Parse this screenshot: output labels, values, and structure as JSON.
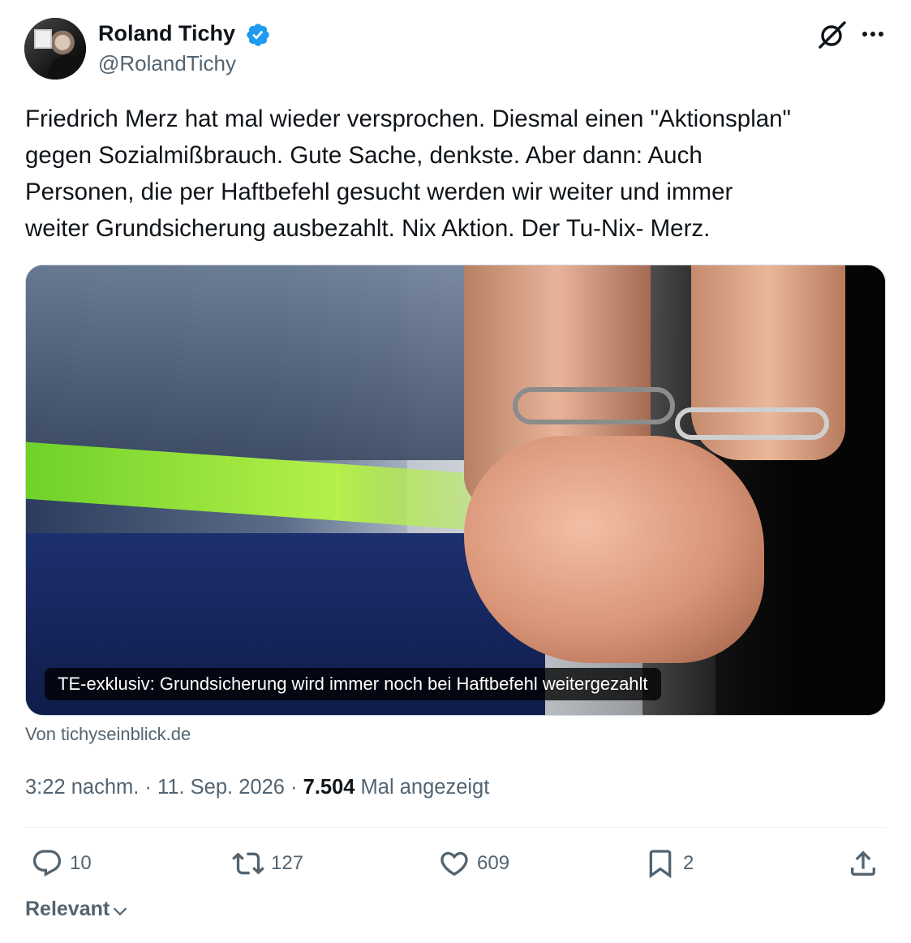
{
  "author": {
    "display_name": "Roland Tichy",
    "handle": "@RolandTichy",
    "verified": true,
    "verified_color": "#1d9bf0"
  },
  "tweet": {
    "text": "Friedrich Merz hat mal wieder versprochen. Diesmal einen \"Aktionsplan\"\ngegen Sozialmißbrauch. Gute Sache, denkste. Aber dann: Auch\nPersonen, die per Haftbefehl gesucht werden wir weiter und immer\nweiter Grundsicherung ausbezahlt. Nix Aktion. Der Tu-Nix- Merz."
  },
  "card": {
    "caption": "TE-exklusiv: Grundsicherung wird immer noch bei Haftbefehl weitergezahlt",
    "source": "Von tichyseinblick.de",
    "image_alt": "handcuffed hands in front of a police car"
  },
  "meta": {
    "time": "3:22 nachm.",
    "separator": "·",
    "date": "11. Sep. 2026",
    "views_count": "7.504",
    "views_label": "Mal angezeigt"
  },
  "actions": {
    "replies": "10",
    "reposts": "127",
    "likes": "609",
    "bookmarks": "2"
  },
  "sort": {
    "label": "Relevant"
  },
  "icons": {
    "header_right": [
      "grok-icon",
      "more-icon"
    ],
    "actions": [
      "reply-icon",
      "repost-icon",
      "like-icon",
      "bookmark-icon",
      "share-icon"
    ]
  }
}
